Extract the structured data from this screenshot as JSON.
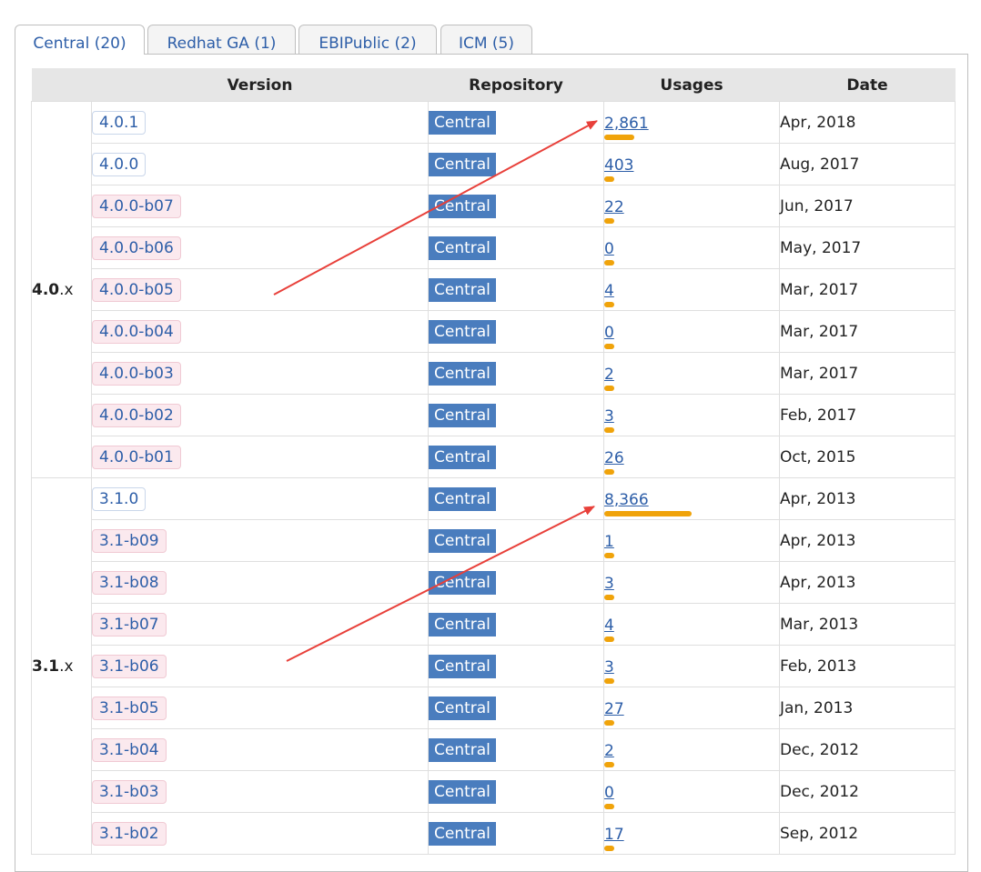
{
  "tabs": [
    {
      "label": "Central (20)",
      "active": true
    },
    {
      "label": "Redhat GA (1)",
      "active": false
    },
    {
      "label": "EBIPublic (2)",
      "active": false
    },
    {
      "label": "ICM (5)",
      "active": false
    }
  ],
  "columns": [
    "Version",
    "Repository",
    "Usages",
    "Date"
  ],
  "groups": [
    {
      "major": "4.0",
      "suffix": ".x",
      "rows": [
        {
          "version": "4.0.1",
          "prerelease": false,
          "repo": "Central",
          "usages": "2,861",
          "usage_count": 2861,
          "date": "Apr, 2018"
        },
        {
          "version": "4.0.0",
          "prerelease": false,
          "repo": "Central",
          "usages": "403",
          "usage_count": 403,
          "date": "Aug, 2017"
        },
        {
          "version": "4.0.0-b07",
          "prerelease": true,
          "repo": "Central",
          "usages": "22",
          "usage_count": 22,
          "date": "Jun, 2017"
        },
        {
          "version": "4.0.0-b06",
          "prerelease": true,
          "repo": "Central",
          "usages": "0",
          "usage_count": 0,
          "date": "May, 2017"
        },
        {
          "version": "4.0.0-b05",
          "prerelease": true,
          "repo": "Central",
          "usages": "4",
          "usage_count": 4,
          "date": "Mar, 2017"
        },
        {
          "version": "4.0.0-b04",
          "prerelease": true,
          "repo": "Central",
          "usages": "0",
          "usage_count": 0,
          "date": "Mar, 2017"
        },
        {
          "version": "4.0.0-b03",
          "prerelease": true,
          "repo": "Central",
          "usages": "2",
          "usage_count": 2,
          "date": "Mar, 2017"
        },
        {
          "version": "4.0.0-b02",
          "prerelease": true,
          "repo": "Central",
          "usages": "3",
          "usage_count": 3,
          "date": "Feb, 2017"
        },
        {
          "version": "4.0.0-b01",
          "prerelease": true,
          "repo": "Central",
          "usages": "26",
          "usage_count": 26,
          "date": "Oct, 2015"
        }
      ]
    },
    {
      "major": "3.1",
      "suffix": ".x",
      "rows": [
        {
          "version": "3.1.0",
          "prerelease": false,
          "repo": "Central",
          "usages": "8,366",
          "usage_count": 8366,
          "date": "Apr, 2013"
        },
        {
          "version": "3.1-b09",
          "prerelease": true,
          "repo": "Central",
          "usages": "1",
          "usage_count": 1,
          "date": "Apr, 2013"
        },
        {
          "version": "3.1-b08",
          "prerelease": true,
          "repo": "Central",
          "usages": "3",
          "usage_count": 3,
          "date": "Apr, 2013"
        },
        {
          "version": "3.1-b07",
          "prerelease": true,
          "repo": "Central",
          "usages": "4",
          "usage_count": 4,
          "date": "Mar, 2013"
        },
        {
          "version": "3.1-b06",
          "prerelease": true,
          "repo": "Central",
          "usages": "3",
          "usage_count": 3,
          "date": "Feb, 2013"
        },
        {
          "version": "3.1-b05",
          "prerelease": true,
          "repo": "Central",
          "usages": "27",
          "usage_count": 27,
          "date": "Jan, 2013"
        },
        {
          "version": "3.1-b04",
          "prerelease": true,
          "repo": "Central",
          "usages": "2",
          "usage_count": 2,
          "date": "Dec, 2012"
        },
        {
          "version": "3.1-b03",
          "prerelease": true,
          "repo": "Central",
          "usages": "0",
          "usage_count": 0,
          "date": "Dec, 2012"
        },
        {
          "version": "3.1-b02",
          "prerelease": true,
          "repo": "Central",
          "usages": "17",
          "usage_count": 17,
          "date": "Sep, 2012"
        }
      ]
    }
  ],
  "colors": {
    "link": "#2d5ea8",
    "repo_badge": "#4a7dbe",
    "usage_bar": "#f0a30a",
    "prerelease_badge": "#fbe9ee",
    "annotation_arrow": "#e8403a"
  },
  "annotations": [
    {
      "type": "arrow",
      "icon": "red-arrow-icon",
      "points_to": "usage 2,861"
    },
    {
      "type": "arrow",
      "icon": "red-arrow-icon",
      "points_to": "usage 8,366"
    }
  ]
}
